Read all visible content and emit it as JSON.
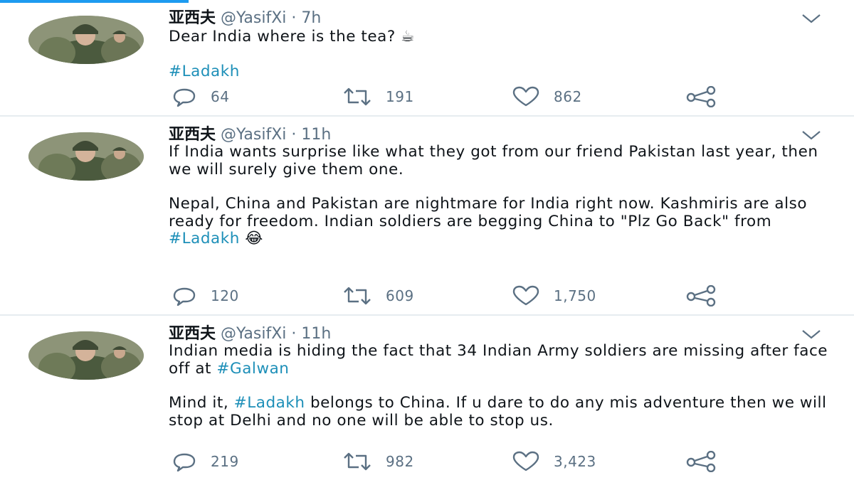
{
  "tweets": [
    {
      "name": "亚西夫",
      "handle": "@YasifXi",
      "time": "7h",
      "text": [
        {
          "segments": [
            {
              "t": "Dear India where is the tea? ☕",
              "tag": false
            }
          ]
        },
        {
          "segments": [
            {
              "t": "#Ladakh",
              "tag": true
            }
          ]
        }
      ],
      "replies": "64",
      "retweets": "191",
      "likes": "862"
    },
    {
      "name": "亚西夫",
      "handle": "@YasifXi",
      "time": "11h",
      "text": [
        {
          "segments": [
            {
              "t": "If India wants surprise like what they got from our friend Pakistan last year, then we will surely give them one.",
              "tag": false
            }
          ]
        },
        {
          "segments": [
            {
              "t": "Nepal, China and Pakistan are nightmare for India right now. Kashmiris are also ready for freedom. Indian soldiers are begging China to \"Plz Go Back\" from ",
              "tag": false
            },
            {
              "t": "#Ladakh",
              "tag": true
            },
            {
              "t": " 😂",
              "tag": false
            }
          ]
        }
      ],
      "replies": "120",
      "retweets": "609",
      "likes": "1,750"
    },
    {
      "name": "亚西夫",
      "handle": "@YasifXi",
      "time": "11h",
      "text": [
        {
          "segments": [
            {
              "t": "Indian media is hiding the fact that 34 Indian Army soldiers are missing after face off at ",
              "tag": false
            },
            {
              "t": "#Galwan",
              "tag": true
            }
          ]
        },
        {
          "segments": [
            {
              "t": "Mind it, ",
              "tag": false
            },
            {
              "t": "#Ladakh",
              "tag": true
            },
            {
              "t": " belongs to China. If u dare to do any mis adventure then we will stop at Delhi and no one will be able to stop us.",
              "tag": false
            }
          ]
        }
      ],
      "replies": "219",
      "retweets": "982",
      "likes": "3,423"
    }
  ],
  "icons": {
    "reply": "reply-icon",
    "retweet": "retweet-icon",
    "like": "heart-icon",
    "share": "share-icon",
    "caret": "chevron-down-icon",
    "avatar": "avatar"
  },
  "colors": {
    "text": "#0f1419",
    "secondary": "#5b7083",
    "hashtag": "#1d8fb8",
    "divider": "#e6ecf0",
    "accent": "#1d9bf0"
  }
}
